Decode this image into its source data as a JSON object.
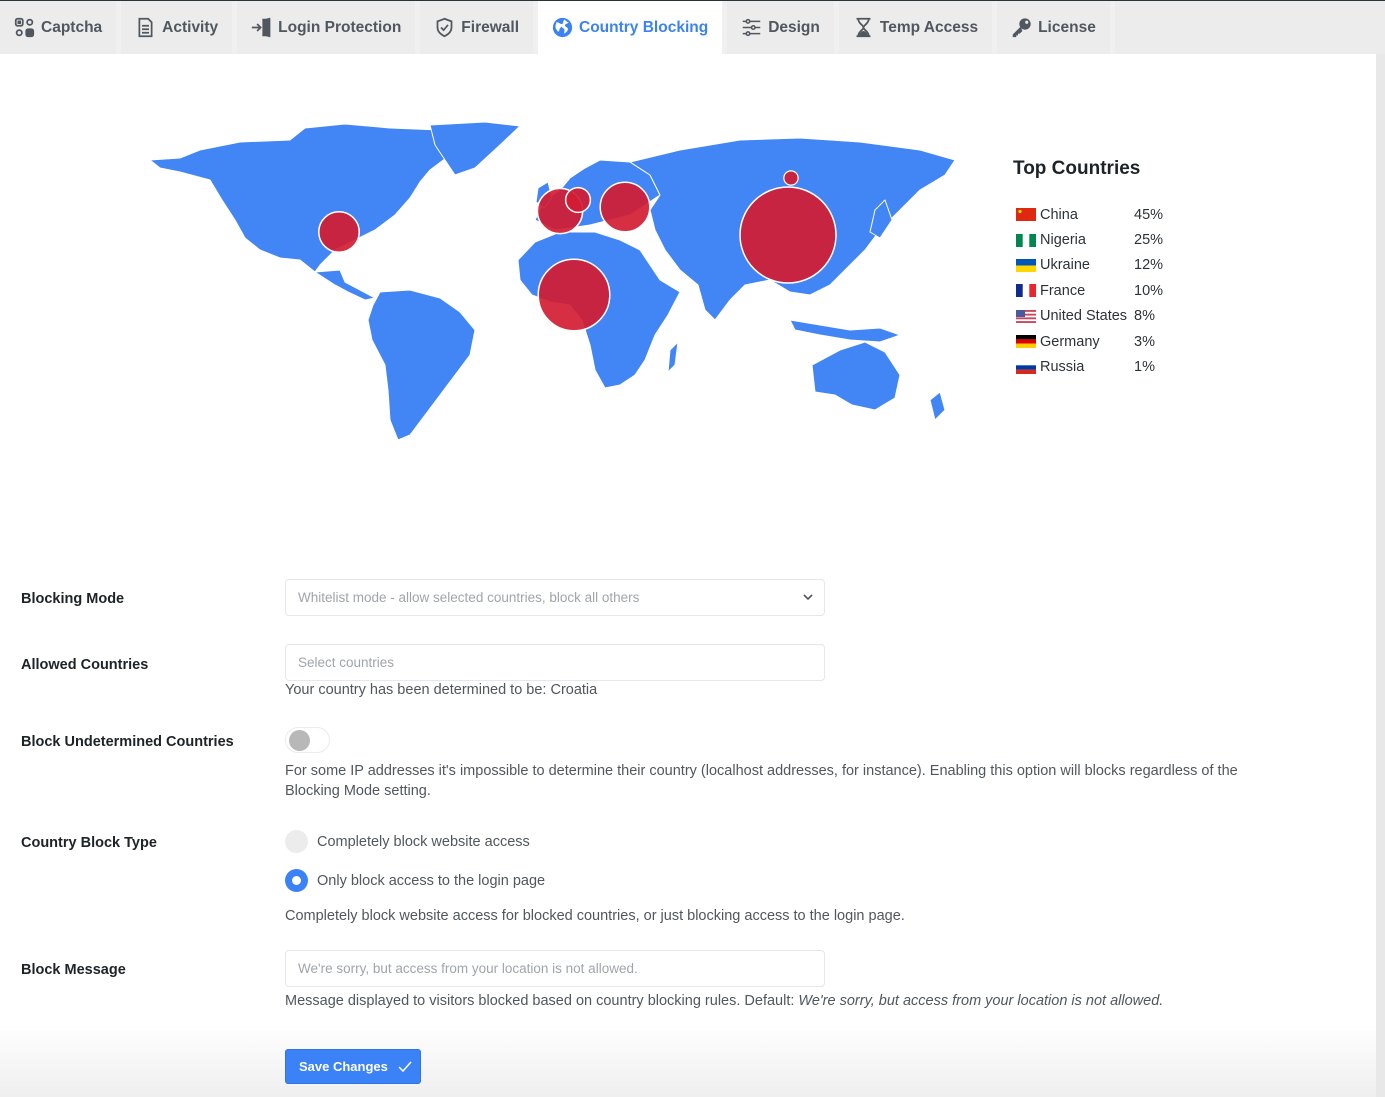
{
  "tabs": [
    {
      "label": "Captcha",
      "icon": "captcha-icon",
      "active": false
    },
    {
      "label": "Activity",
      "icon": "document-icon",
      "active": false
    },
    {
      "label": "Login Protection",
      "icon": "login-door-icon",
      "active": false
    },
    {
      "label": "Firewall",
      "icon": "shield-check-icon",
      "active": false
    },
    {
      "label": "Country Blocking",
      "icon": "globe-icon",
      "active": true
    },
    {
      "label": "Design",
      "icon": "sliders-icon",
      "active": false
    },
    {
      "label": "Temp Access",
      "icon": "hourglass-icon",
      "active": false
    },
    {
      "label": "License",
      "icon": "key-icon",
      "active": false
    }
  ],
  "colors": {
    "accent": "#3b82f6",
    "map_land": "#4285f4",
    "bubble": "#d21c32"
  },
  "map": {
    "bubbles": [
      {
        "country": "China",
        "percent": 45
      },
      {
        "country": "Nigeria",
        "percent": 25
      },
      {
        "country": "Ukraine",
        "percent": 12
      },
      {
        "country": "France",
        "percent": 10
      },
      {
        "country": "United States",
        "percent": 8
      },
      {
        "country": "Germany",
        "percent": 3
      },
      {
        "country": "Russia",
        "percent": 1
      }
    ]
  },
  "top_countries": {
    "title": "Top Countries",
    "rows": [
      {
        "name": "China",
        "value": "45%",
        "flag": "flag-china"
      },
      {
        "name": "Nigeria",
        "value": "25%",
        "flag": "flag-nigeria"
      },
      {
        "name": "Ukraine",
        "value": "12%",
        "flag": "flag-ukraine"
      },
      {
        "name": "France",
        "value": "10%",
        "flag": "flag-france"
      },
      {
        "name": "United States",
        "value": "8%",
        "flag": "flag-usa"
      },
      {
        "name": "Germany",
        "value": "3%",
        "flag": "flag-germany"
      },
      {
        "name": "Russia",
        "value": "1%",
        "flag": "flag-russia"
      }
    ]
  },
  "form": {
    "blocking_mode": {
      "label": "Blocking Mode",
      "value": "Whitelist mode - allow selected countries, block all others"
    },
    "allowed_countries": {
      "label": "Allowed Countries",
      "placeholder": "Select countries",
      "help": "Your country has been determined to be: Croatia"
    },
    "block_undetermined": {
      "label": "Block Undetermined Countries",
      "enabled": false,
      "help": "For some IP addresses it's impossible to determine their country (localhost addresses, for instance). Enabling this option will blocks regardless of the Blocking Mode setting."
    },
    "block_type": {
      "label": "Country Block Type",
      "options": [
        {
          "label": "Completely block website access",
          "selected": false
        },
        {
          "label": "Only block access to the login page",
          "selected": true
        }
      ],
      "help": "Completely block website access for blocked countries, or just blocking access to the login page."
    },
    "block_message": {
      "label": "Block Message",
      "placeholder": "We're sorry, but access from your location is not allowed.",
      "help_prefix": "Message displayed to visitors blocked based on country blocking rules. Default: ",
      "help_default": "We're sorry, but access from your location is not allowed."
    },
    "save_label": "Save Changes"
  }
}
